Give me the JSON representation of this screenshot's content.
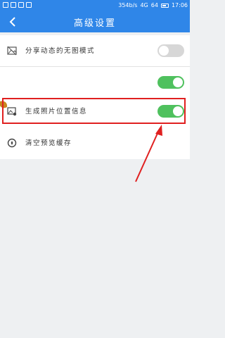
{
  "status_bar": {
    "network_speed": "354b/s",
    "signal": "4G",
    "battery_percent": "64",
    "time": "17:06"
  },
  "nav": {
    "title": "高级设置",
    "back_icon": "chevron-left-icon"
  },
  "settings": [
    {
      "icon": "image-icon",
      "label": "分享动态的无图模式",
      "toggle_on": false
    },
    {
      "icon": "",
      "label": "",
      "toggle_on": true
    },
    {
      "icon": "image-location-icon",
      "label": "生成照片位置信息",
      "toggle_on": true
    },
    {
      "icon": "compass-icon",
      "label": "清空预览缓存",
      "toggle_on": null
    }
  ],
  "colors": {
    "header": "#2f86e8",
    "toggle_on": "#4fc15e",
    "toggle_off": "#d7d7d7",
    "highlight": "#e02020"
  }
}
